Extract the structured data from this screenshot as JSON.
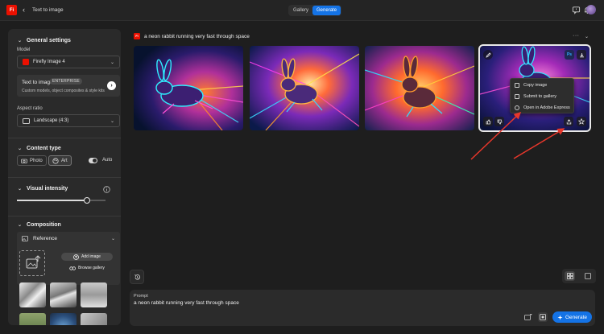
{
  "app": {
    "logo_text": "Fi",
    "title": "Text to image",
    "back_icon": "chevron-left-icon",
    "modes": [
      "Gallery",
      "Generate"
    ],
    "active_mode": "Generate",
    "brand_color": "#eb1000",
    "accent_color": "#1473e6"
  },
  "sidebar": {
    "general": {
      "title": "General settings",
      "model_label": "Model",
      "model_value": "Firefly Image 4",
      "tti_title": "Text to image",
      "tti_badge": "ENTERPRISE",
      "tti_sub": "Custom models, object composites & style kits",
      "aspect_label": "Aspect ratio",
      "aspect_value": "Landscape (4:3)"
    },
    "content_type": {
      "title": "Content type",
      "options": [
        "Photo",
        "Art"
      ],
      "selected": "Art",
      "auto_label": "Auto",
      "auto_on": true
    },
    "visual_intensity": {
      "title": "Visual intensity",
      "value_fraction": 0.79
    },
    "composition": {
      "title": "Composition",
      "reference_label": "Reference",
      "add_image_label": "Add image",
      "browse_label": "Browse gallery"
    }
  },
  "main": {
    "prompt_title": "a neon rabbit running very fast through space",
    "context_menu": [
      "Copy image",
      "Submit to gallery",
      "Open in Adobe Express"
    ],
    "prompt_label": "Prompt",
    "prompt_value": "a neon rabbit running very fast through space",
    "generate_label": "Generate"
  }
}
